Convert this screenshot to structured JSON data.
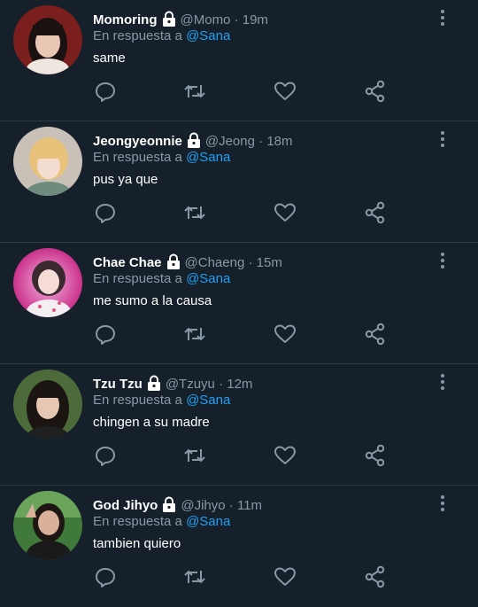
{
  "reply_prefix": "En respuesta a",
  "colors": {
    "background": "#15202b",
    "text": "#ffffff",
    "secondary": "#8899a6",
    "mention": "#1da1f2",
    "divider": "#2f3b47"
  },
  "icons": [
    "lock-icon",
    "more-icon",
    "reply-icon",
    "retweet-icon",
    "like-icon",
    "share-icon"
  ],
  "tweets": [
    {
      "name": "Momoring",
      "handle": "@Momo",
      "time": "19m",
      "mention": "@Sana",
      "text": "same"
    },
    {
      "name": "Jeongyeonnie",
      "handle": "@Jeong",
      "time": "18m",
      "mention": "@Sana",
      "text": "pus ya que"
    },
    {
      "name": "Chae Chae",
      "handle": "@Chaeng",
      "time": "15m",
      "mention": "@Sana",
      "text": "me sumo a la causa"
    },
    {
      "name": "Tzu Tzu",
      "handle": "@Tzuyu",
      "time": "12m",
      "mention": "@Sana",
      "text": "chingen a su madre"
    },
    {
      "name": "God Jihyo",
      "handle": "@Jihyo",
      "time": "11m",
      "mention": "@Sana",
      "text": "tambien quiero"
    }
  ]
}
